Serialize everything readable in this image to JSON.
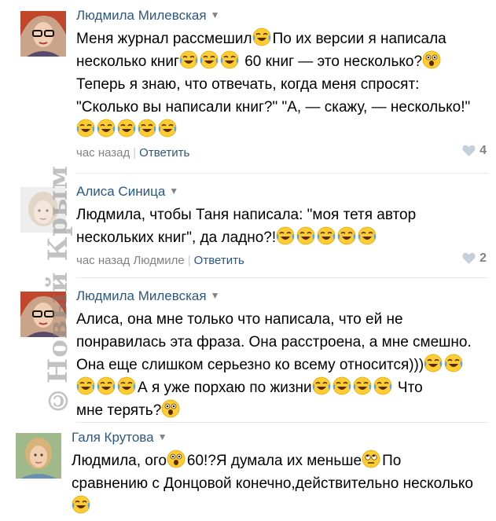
{
  "watermark": "©Новый Крым",
  "comments": [
    {
      "author": "Людмила Милевская",
      "caret": "▼",
      "lines": [
        [
          {
            "t": "Меня журнал рассмешил"
          },
          {
            "e": "joy"
          },
          {
            "t": "По их версии я написала"
          }
        ],
        [
          {
            "t": "несколько книг"
          },
          {
            "e": "joy"
          },
          {
            "e": "joy"
          },
          {
            "e": "joy"
          },
          {
            "t": " 60 книг — это несколько?"
          },
          {
            "e": "wow"
          }
        ],
        [
          {
            "t": "Теперь я знаю, что отвечать, когда меня спросят:"
          }
        ],
        [
          {
            "t": "\"Сколько вы написали книг?\" \"А, — скажу, — несколько!\""
          }
        ],
        [
          {
            "e": "joy"
          },
          {
            "e": "joy"
          },
          {
            "e": "joy"
          },
          {
            "e": "joy"
          },
          {
            "e": "joy"
          }
        ]
      ],
      "time": "час назад",
      "reply_to": "",
      "reply_label": "Ответить",
      "likes": "4"
    },
    {
      "author": "Алиса Синица",
      "caret": "▼",
      "lines": [
        [
          {
            "t": "Людмила, чтобы Таня написала: \"моя тетя автор"
          }
        ],
        [
          {
            "t": "нескольких книг\", да ладно?!"
          },
          {
            "e": "joy"
          },
          {
            "e": "joy"
          },
          {
            "e": "joy"
          },
          {
            "e": "joy"
          },
          {
            "e": "joy"
          }
        ]
      ],
      "time": "час назад",
      "reply_to": "Людмиле",
      "reply_label": "Ответить",
      "likes": "2"
    },
    {
      "author": "Людмила Милевская",
      "caret": "▼",
      "lines": [
        [
          {
            "t": "Алиса, она мне только что написала, что ей не"
          }
        ],
        [
          {
            "t": "понравилась эта фраза. Она расстроена, а мне смешно."
          }
        ],
        [
          {
            "t": "Она еще слишком серьезно ко всему относится)))"
          },
          {
            "e": "joy"
          },
          {
            "e": "joy"
          }
        ],
        [
          {
            "e": "joy"
          },
          {
            "e": "joy"
          },
          {
            "e": "joy"
          },
          {
            "t": "А я уже порхаю по жизни"
          },
          {
            "e": "joy"
          },
          {
            "e": "joy"
          },
          {
            "e": "joy"
          },
          {
            "e": "joy"
          },
          {
            "t": " Что"
          }
        ],
        [
          {
            "t": "мне терять?"
          },
          {
            "e": "wow"
          }
        ]
      ],
      "time": "",
      "reply_to": "",
      "reply_label": "",
      "likes": ""
    },
    {
      "author": "Галя Крутова",
      "caret": "▼",
      "lines": [
        [
          {
            "t": "Людмила, ого"
          },
          {
            "e": "wow"
          },
          {
            "t": "60!?Я думала их меньше"
          },
          {
            "e": "roll"
          },
          {
            "t": "По"
          }
        ],
        [
          {
            "t": "сравнению с Донцовой конечно,действительно несколько"
          }
        ],
        [
          {
            "e": "joy"
          }
        ]
      ],
      "time": "",
      "reply_to": "",
      "reply_label": "",
      "likes": ""
    }
  ]
}
